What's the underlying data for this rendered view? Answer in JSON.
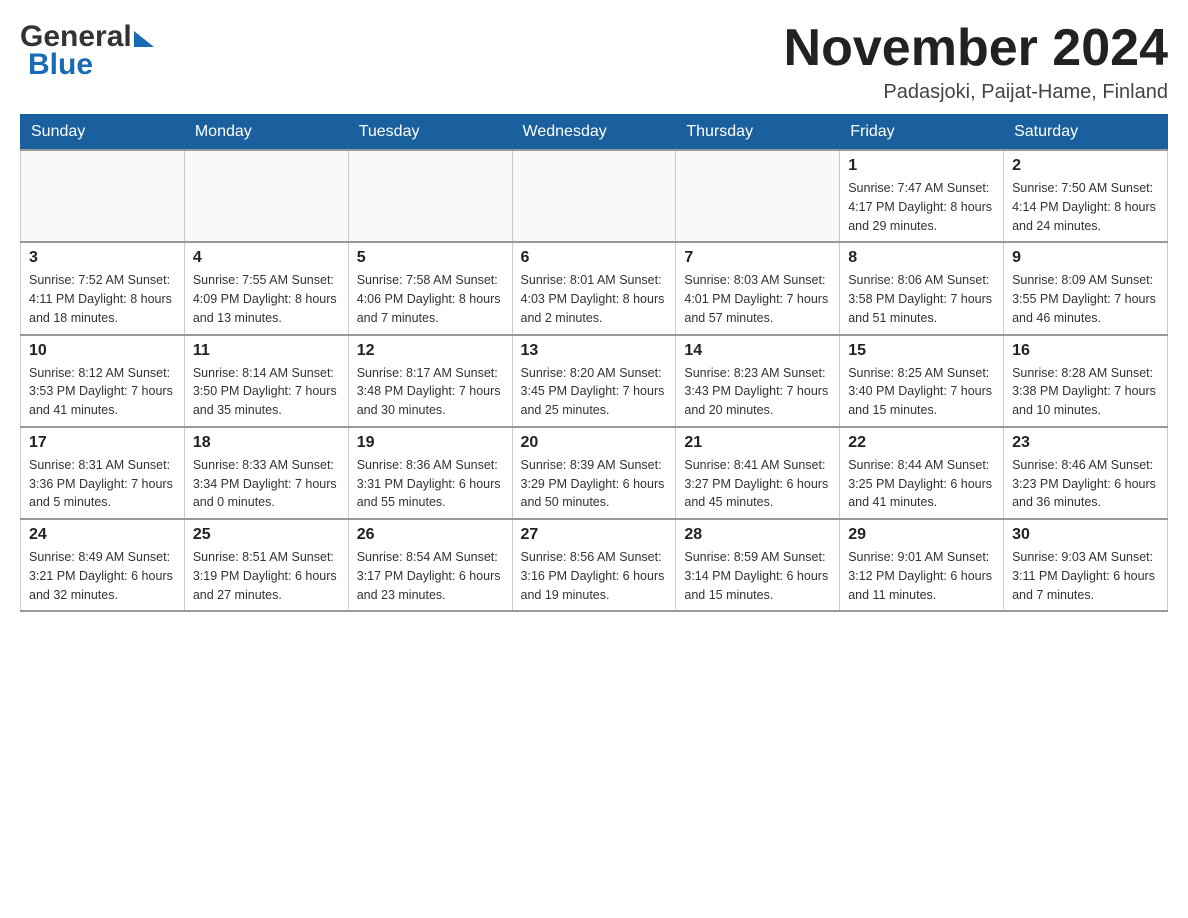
{
  "header": {
    "logo_general": "General",
    "logo_blue": "Blue",
    "month_title": "November 2024",
    "location": "Padasjoki, Paijat-Hame, Finland"
  },
  "days_of_week": [
    "Sunday",
    "Monday",
    "Tuesday",
    "Wednesday",
    "Thursday",
    "Friday",
    "Saturday"
  ],
  "weeks": [
    {
      "days": [
        {
          "num": "",
          "info": ""
        },
        {
          "num": "",
          "info": ""
        },
        {
          "num": "",
          "info": ""
        },
        {
          "num": "",
          "info": ""
        },
        {
          "num": "",
          "info": ""
        },
        {
          "num": "1",
          "info": "Sunrise: 7:47 AM\nSunset: 4:17 PM\nDaylight: 8 hours\nand 29 minutes."
        },
        {
          "num": "2",
          "info": "Sunrise: 7:50 AM\nSunset: 4:14 PM\nDaylight: 8 hours\nand 24 minutes."
        }
      ]
    },
    {
      "days": [
        {
          "num": "3",
          "info": "Sunrise: 7:52 AM\nSunset: 4:11 PM\nDaylight: 8 hours\nand 18 minutes."
        },
        {
          "num": "4",
          "info": "Sunrise: 7:55 AM\nSunset: 4:09 PM\nDaylight: 8 hours\nand 13 minutes."
        },
        {
          "num": "5",
          "info": "Sunrise: 7:58 AM\nSunset: 4:06 PM\nDaylight: 8 hours\nand 7 minutes."
        },
        {
          "num": "6",
          "info": "Sunrise: 8:01 AM\nSunset: 4:03 PM\nDaylight: 8 hours\nand 2 minutes."
        },
        {
          "num": "7",
          "info": "Sunrise: 8:03 AM\nSunset: 4:01 PM\nDaylight: 7 hours\nand 57 minutes."
        },
        {
          "num": "8",
          "info": "Sunrise: 8:06 AM\nSunset: 3:58 PM\nDaylight: 7 hours\nand 51 minutes."
        },
        {
          "num": "9",
          "info": "Sunrise: 8:09 AM\nSunset: 3:55 PM\nDaylight: 7 hours\nand 46 minutes."
        }
      ]
    },
    {
      "days": [
        {
          "num": "10",
          "info": "Sunrise: 8:12 AM\nSunset: 3:53 PM\nDaylight: 7 hours\nand 41 minutes."
        },
        {
          "num": "11",
          "info": "Sunrise: 8:14 AM\nSunset: 3:50 PM\nDaylight: 7 hours\nand 35 minutes."
        },
        {
          "num": "12",
          "info": "Sunrise: 8:17 AM\nSunset: 3:48 PM\nDaylight: 7 hours\nand 30 minutes."
        },
        {
          "num": "13",
          "info": "Sunrise: 8:20 AM\nSunset: 3:45 PM\nDaylight: 7 hours\nand 25 minutes."
        },
        {
          "num": "14",
          "info": "Sunrise: 8:23 AM\nSunset: 3:43 PM\nDaylight: 7 hours\nand 20 minutes."
        },
        {
          "num": "15",
          "info": "Sunrise: 8:25 AM\nSunset: 3:40 PM\nDaylight: 7 hours\nand 15 minutes."
        },
        {
          "num": "16",
          "info": "Sunrise: 8:28 AM\nSunset: 3:38 PM\nDaylight: 7 hours\nand 10 minutes."
        }
      ]
    },
    {
      "days": [
        {
          "num": "17",
          "info": "Sunrise: 8:31 AM\nSunset: 3:36 PM\nDaylight: 7 hours\nand 5 minutes."
        },
        {
          "num": "18",
          "info": "Sunrise: 8:33 AM\nSunset: 3:34 PM\nDaylight: 7 hours\nand 0 minutes."
        },
        {
          "num": "19",
          "info": "Sunrise: 8:36 AM\nSunset: 3:31 PM\nDaylight: 6 hours\nand 55 minutes."
        },
        {
          "num": "20",
          "info": "Sunrise: 8:39 AM\nSunset: 3:29 PM\nDaylight: 6 hours\nand 50 minutes."
        },
        {
          "num": "21",
          "info": "Sunrise: 8:41 AM\nSunset: 3:27 PM\nDaylight: 6 hours\nand 45 minutes."
        },
        {
          "num": "22",
          "info": "Sunrise: 8:44 AM\nSunset: 3:25 PM\nDaylight: 6 hours\nand 41 minutes."
        },
        {
          "num": "23",
          "info": "Sunrise: 8:46 AM\nSunset: 3:23 PM\nDaylight: 6 hours\nand 36 minutes."
        }
      ]
    },
    {
      "days": [
        {
          "num": "24",
          "info": "Sunrise: 8:49 AM\nSunset: 3:21 PM\nDaylight: 6 hours\nand 32 minutes."
        },
        {
          "num": "25",
          "info": "Sunrise: 8:51 AM\nSunset: 3:19 PM\nDaylight: 6 hours\nand 27 minutes."
        },
        {
          "num": "26",
          "info": "Sunrise: 8:54 AM\nSunset: 3:17 PM\nDaylight: 6 hours\nand 23 minutes."
        },
        {
          "num": "27",
          "info": "Sunrise: 8:56 AM\nSunset: 3:16 PM\nDaylight: 6 hours\nand 19 minutes."
        },
        {
          "num": "28",
          "info": "Sunrise: 8:59 AM\nSunset: 3:14 PM\nDaylight: 6 hours\nand 15 minutes."
        },
        {
          "num": "29",
          "info": "Sunrise: 9:01 AM\nSunset: 3:12 PM\nDaylight: 6 hours\nand 11 minutes."
        },
        {
          "num": "30",
          "info": "Sunrise: 9:03 AM\nSunset: 3:11 PM\nDaylight: 6 hours\nand 7 minutes."
        }
      ]
    }
  ]
}
